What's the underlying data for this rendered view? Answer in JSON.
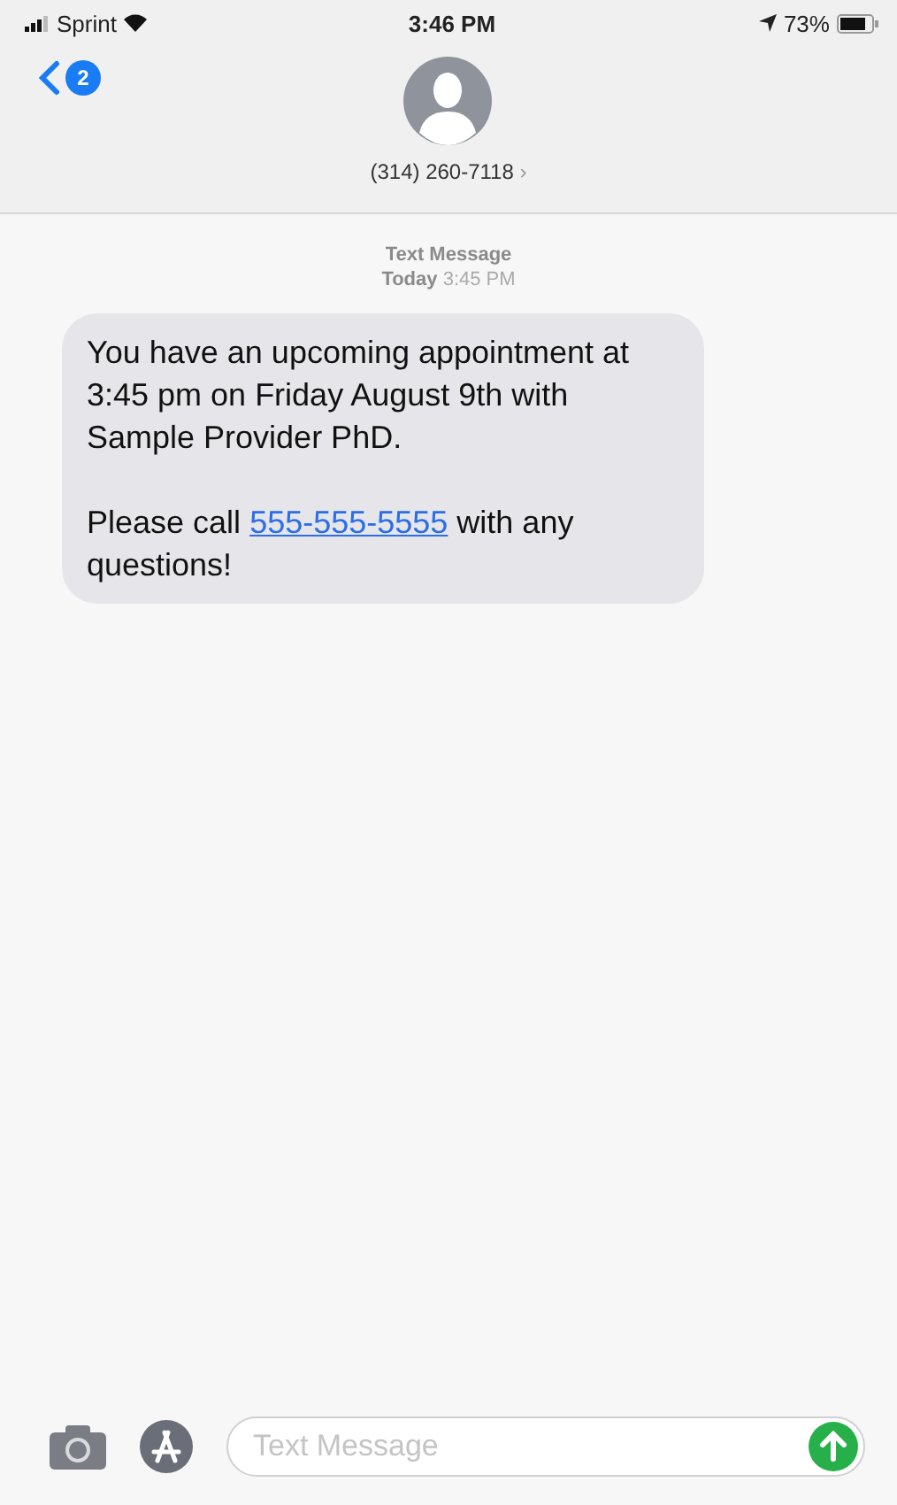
{
  "status_bar": {
    "carrier": "Sprint",
    "time": "3:46 PM",
    "battery": "73%"
  },
  "nav": {
    "unread_badge": "2",
    "contact": "(314) 260-7118",
    "chevron": "›"
  },
  "thread": {
    "service": "Text Message",
    "timestamp_day": "Today",
    "timestamp_time": "3:45 PM"
  },
  "messages": [
    {
      "paragraphs": [
        [
          {
            "kind": "text",
            "text": "You have an upcoming appointment at 3:45 pm on Friday August 9th with Sample Provider PhD."
          }
        ],
        [
          {
            "kind": "text",
            "text": "Please call "
          },
          {
            "kind": "link",
            "text": "555-555-5555"
          },
          {
            "kind": "text",
            "text": " with any questions!"
          }
        ]
      ]
    }
  ],
  "composer": {
    "placeholder": "Text Message"
  }
}
